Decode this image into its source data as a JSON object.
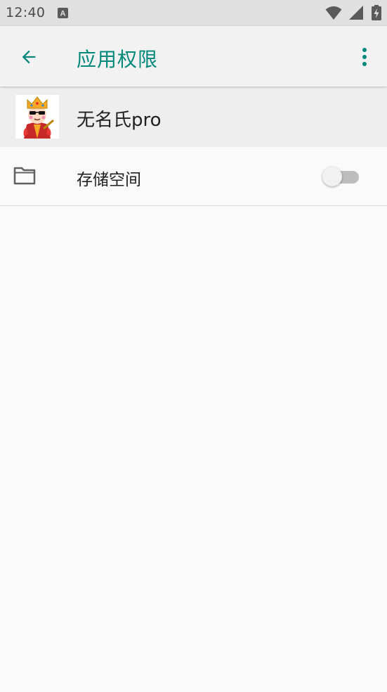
{
  "status_bar": {
    "time": "12:40",
    "icons": [
      "font-notification-icon",
      "wifi-icon",
      "cell-signal-icon",
      "battery-charging-icon"
    ]
  },
  "toolbar": {
    "title": "应用权限",
    "icons": [
      "back-arrow-icon",
      "more-vert-icon"
    ],
    "accent_color": "#00897b"
  },
  "app": {
    "name": "无名氏pro",
    "avatar": "crowned-emoji-avatar"
  },
  "permissions": [
    {
      "label": "存储空间",
      "icon": "folder-icon",
      "enabled": false
    }
  ]
}
